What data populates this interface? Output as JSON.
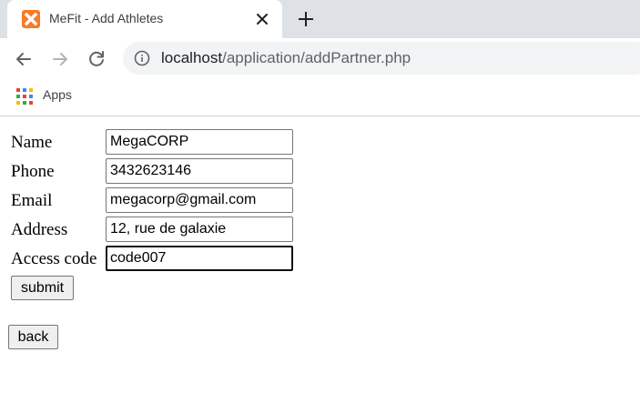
{
  "browser": {
    "tab": {
      "title": "MeFit - Add Athletes"
    },
    "url": {
      "host": "localhost",
      "path": "/application/addPartner.php"
    },
    "bookmarks": {
      "apps_label": "Apps"
    }
  },
  "form": {
    "fields": [
      {
        "label": "Name",
        "value": "MegaCORP"
      },
      {
        "label": "Phone",
        "value": "3432623146"
      },
      {
        "label": "Email",
        "value": "megacorp@gmail.com"
      },
      {
        "label": "Address",
        "value": "12, rue de galaxie"
      },
      {
        "label": "Access code",
        "value": "code007"
      }
    ],
    "submit_label": "submit",
    "back_label": "back"
  }
}
